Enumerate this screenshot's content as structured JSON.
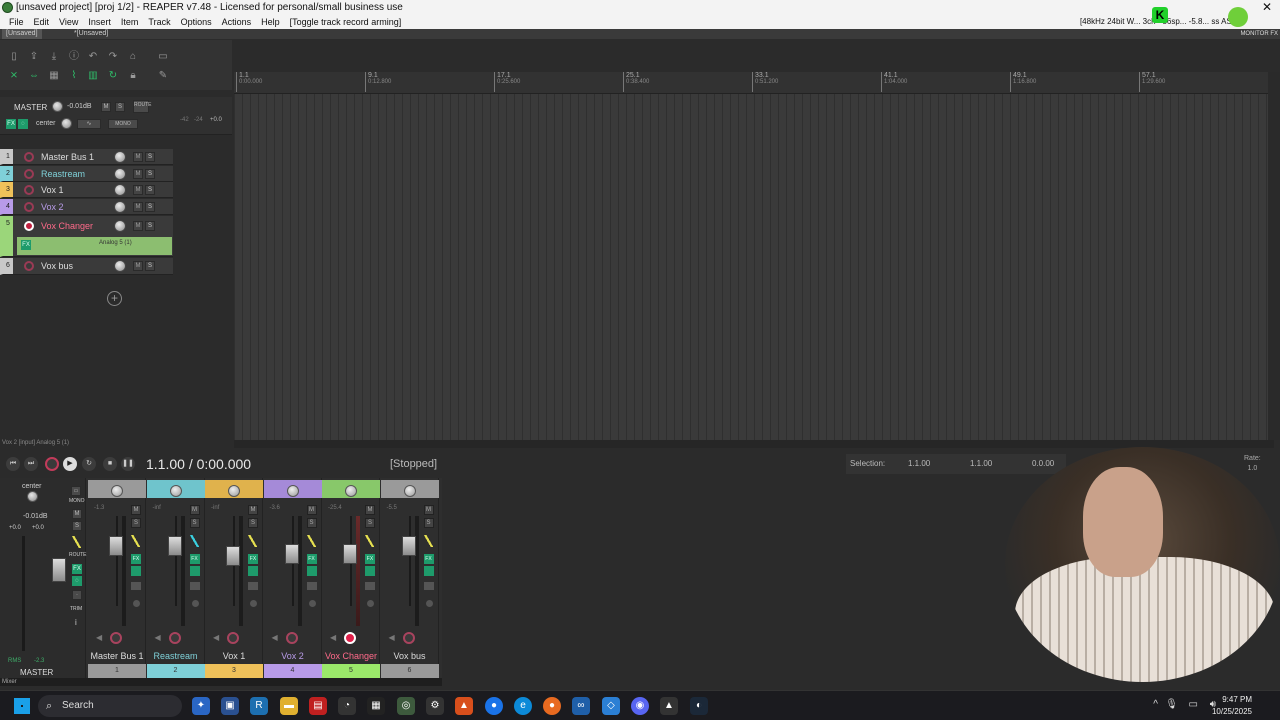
{
  "window": {
    "title": "[unsaved project] [proj 1/2] - REAPER v7.48 - Licensed for personal/small business use",
    "close": "✕",
    "status_right": "[48kHz 24bit W... 3ch ~56sp... -5.8... ss AS'..."
  },
  "menu": [
    "File",
    "Edit",
    "View",
    "Insert",
    "Item",
    "Track",
    "Options",
    "Actions",
    "Help",
    "[Toggle track record arming]"
  ],
  "tabs": {
    "tab1": "[Unsaved]",
    "tab2": "*[Unsaved]",
    "monitor": "MONITOR FX"
  },
  "master_tcp": {
    "label": "MASTER",
    "volume": "-0.01dB",
    "pan": "center",
    "route": "ROUTE",
    "mono": "MONO",
    "meter_l": "-42",
    "meter_r": "-24",
    "meter_val": "+0.0"
  },
  "tracks": [
    {
      "num": "1",
      "name": "Master Bus 1",
      "color": "#c8c8c8"
    },
    {
      "num": "2",
      "name": "Reastream",
      "color": "#7fd0d8"
    },
    {
      "num": "3",
      "name": "Vox 1",
      "color": "#efc15a"
    },
    {
      "num": "4",
      "name": "Vox 2",
      "color": "#b89be8"
    },
    {
      "num": "5",
      "name": "Vox Changer",
      "color": "#9bd67a",
      "input": "Analog 5 (1)"
    },
    {
      "num": "6",
      "name": "Vox bus",
      "color": "#c8c8c8"
    }
  ],
  "ruler": [
    {
      "bar": "1.1",
      "time": "0:00.000"
    },
    {
      "bar": "9.1",
      "time": "0:12.800"
    },
    {
      "bar": "17.1",
      "time": "0:25.600"
    },
    {
      "bar": "25.1",
      "time": "0:38.400"
    },
    {
      "bar": "33.1",
      "time": "0:51.200"
    },
    {
      "bar": "41.1",
      "time": "1:04.000"
    },
    {
      "bar": "49.1",
      "time": "1:16.800"
    },
    {
      "bar": "57.1",
      "time": "1:29.600"
    }
  ],
  "status_line": "Vox 2 [input] Analog 5 (1)",
  "transport": {
    "position": "1.1.00 / 0:00.000",
    "state": "[Stopped]",
    "selection_label": "Selection:",
    "sel_start": "1.1.00",
    "sel_end": "1.1.00",
    "sel_len": "0.0.00",
    "rate_label": "Rate:",
    "rate": "1.0"
  },
  "mixer": {
    "master": {
      "label": "MASTER",
      "pan": "center",
      "volume": "-0.01dB",
      "peak_l": "+0.0",
      "peak_r": "+0.0",
      "rms": "RMS",
      "rms_val": "-2.3",
      "route": "ROUTE",
      "trim": "TRIM",
      "mono": "MONO"
    },
    "strips": [
      {
        "name": "Master Bus 1",
        "idx": "1",
        "db": "-1.3",
        "color": "#9a9a9a",
        "rec_on": false
      },
      {
        "name": "Reastream",
        "idx": "2",
        "db": "-inf",
        "color": "#6fc4cc",
        "rec_on": false
      },
      {
        "name": "Vox 1",
        "idx": "3",
        "db": "-inf",
        "color": "#e0b24c",
        "rec_on": false
      },
      {
        "name": "Vox 2",
        "idx": "4",
        "db": "-3.6",
        "color": "#a58ad8",
        "rec_on": false
      },
      {
        "name": "Vox Changer",
        "idx": "5",
        "db": "-25.4",
        "color": "#88c86a",
        "rec_on": true
      },
      {
        "name": "Vox bus",
        "idx": "6",
        "db": "-5.5",
        "color": "#9a9a9a",
        "rec_on": false
      }
    ],
    "label": "Mixer"
  },
  "taskbar": {
    "search": "Search",
    "time": "9:47 PM",
    "date": "10/25/2025"
  }
}
